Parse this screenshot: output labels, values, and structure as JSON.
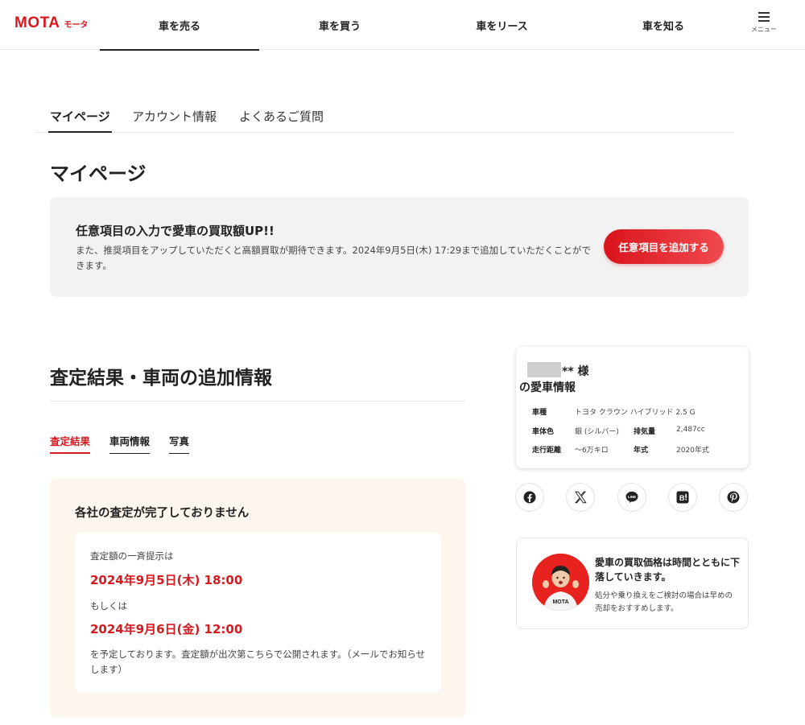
{
  "header": {
    "logo_main": "MOTA",
    "logo_sub": "モータ",
    "nav": [
      "車を売る",
      "車を買う",
      "車をリース",
      "車を知る"
    ],
    "menu_label": "メニュー"
  },
  "subtabs": [
    "マイページ",
    "アカウント情報",
    "よくあるご質問"
  ],
  "page_title": "マイページ",
  "notice": {
    "title": "任意項目の入力で愛車の買取額UP!!",
    "text": "また、推奨項目をアップしていただくと高額買取が期待できます。2024年9月5日(木) 17:29まで追加していただくことができます。",
    "button": "任意項目を追加する"
  },
  "section": {
    "title": "査定結果・車両の追加情報",
    "tabs": [
      "査定結果",
      "車両情報",
      "写真"
    ]
  },
  "result": {
    "title": "各社の査定が完了しておりません",
    "label1": "査定額の一斉提示は",
    "date1": "2024年9月5日(木) 18:00",
    "label2": "もしくは",
    "date2": "2024年9月6日(金) 12:00",
    "note": "を予定しております。査定額が出次第こちらで公開されます。（メールでお知らせします）"
  },
  "car": {
    "name_suffix": "** 様",
    "title": "の愛車情報",
    "specs": {
      "model_k": "車種",
      "model_v": "トヨタ クラウン ハイブリッド 2.5 G",
      "color_k": "車体色",
      "color_v": "銀 (シルバー)",
      "disp_k": "排気量",
      "disp_v": "2,487cc",
      "mileage_k": "走行距離",
      "mileage_v": "〜6万キロ",
      "year_k": "年式",
      "year_v": "2020年式"
    }
  },
  "share_icons": [
    "facebook-icon",
    "x-icon",
    "line-icon",
    "hatena-bookmark-icon",
    "pinterest-icon"
  ],
  "promo": {
    "title": "愛車の買取価格は時間とともに下落していきます。",
    "text": "処分や乗り換えをご検討の場合は早めの売却をおすすめします。",
    "avatar_shirt": "MOTA"
  },
  "colors": {
    "brand_red": "#d71920",
    "notice_bg": "#f2f2f2",
    "result_bg": "#fdf6ef"
  }
}
